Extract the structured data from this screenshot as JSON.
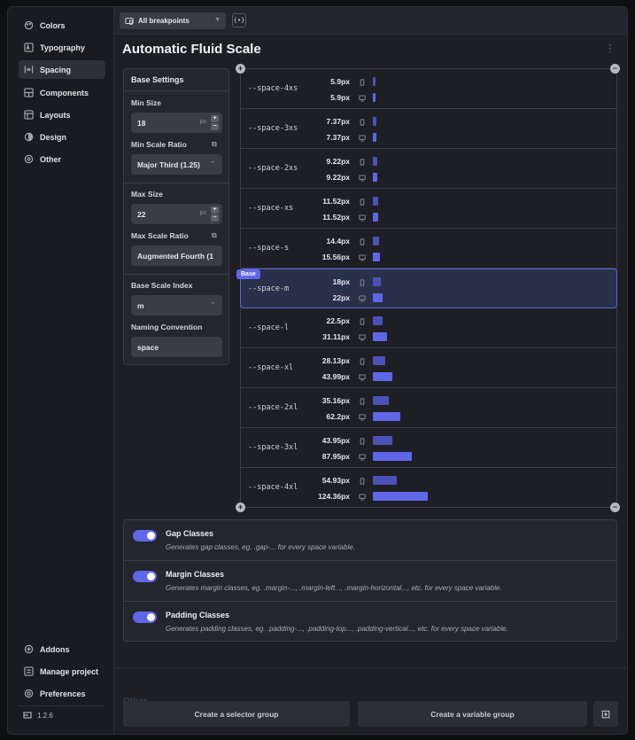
{
  "sidebar": {
    "items": [
      {
        "label": "Colors",
        "icon": "palette-icon"
      },
      {
        "label": "Typography",
        "icon": "typography-icon"
      },
      {
        "label": "Spacing",
        "icon": "spacing-icon"
      },
      {
        "label": "Components",
        "icon": "components-icon"
      },
      {
        "label": "Layouts",
        "icon": "layouts-icon"
      },
      {
        "label": "Design",
        "icon": "design-icon"
      },
      {
        "label": "Other",
        "icon": "other-icon"
      }
    ],
    "bottom_items": [
      {
        "label": "Addons",
        "icon": "addons-icon"
      },
      {
        "label": "Manage project",
        "icon": "manage-project-icon"
      },
      {
        "label": "Preferences",
        "icon": "preferences-icon"
      }
    ],
    "version": "1.2.6",
    "active": "Spacing"
  },
  "topbar": {
    "breakpoint_select": "All breakpoints",
    "code_button": "{•}"
  },
  "page_title": "Automatic Fluid Scale",
  "settings": {
    "header": "Base Settings",
    "min_size_label": "Min Size",
    "min_size_value": "18",
    "min_size_unit": "px",
    "min_scale_ratio_label": "Min Scale Ratio",
    "min_scale_ratio_value": "Major Third (1.25)",
    "max_size_label": "Max Size",
    "max_size_value": "22",
    "max_size_unit": "px",
    "max_scale_ratio_label": "Max Scale Ratio",
    "max_scale_ratio_value": "Augmented Fourth (1",
    "base_scale_index_label": "Base Scale Index",
    "base_scale_index_value": "m",
    "naming_convention_label": "Naming Convention",
    "naming_convention_value": "space"
  },
  "scale": {
    "base_badge": "Base",
    "base_index": 5,
    "rows": [
      {
        "name": "--space-4xs",
        "min": "5.9px",
        "max": "5.9px",
        "min_val": 5.9,
        "max_val": 5.9
      },
      {
        "name": "--space-3xs",
        "min": "7.37px",
        "max": "7.37px",
        "min_val": 7.37,
        "max_val": 7.37
      },
      {
        "name": "--space-2xs",
        "min": "9.22px",
        "max": "9.22px",
        "min_val": 9.22,
        "max_val": 9.22
      },
      {
        "name": "--space-xs",
        "min": "11.52px",
        "max": "11.52px",
        "min_val": 11.52,
        "max_val": 11.52
      },
      {
        "name": "--space-s",
        "min": "14.4px",
        "max": "15.56px",
        "min_val": 14.4,
        "max_val": 15.56
      },
      {
        "name": "--space-m",
        "min": "18px",
        "max": "22px",
        "min_val": 18,
        "max_val": 22
      },
      {
        "name": "--space-l",
        "min": "22.5px",
        "max": "31.11px",
        "min_val": 22.5,
        "max_val": 31.11
      },
      {
        "name": "--space-xl",
        "min": "28.13px",
        "max": "43.99px",
        "min_val": 28.13,
        "max_val": 43.99
      },
      {
        "name": "--space-2xl",
        "min": "35.16px",
        "max": "62.2px",
        "min_val": 35.16,
        "max_val": 62.2
      },
      {
        "name": "--space-3xl",
        "min": "43.95px",
        "max": "87.95px",
        "min_val": 43.95,
        "max_val": 87.95
      },
      {
        "name": "--space-4xl",
        "min": "54.93px",
        "max": "124.36px",
        "min_val": 54.93,
        "max_val": 124.36
      }
    ]
  },
  "classes": [
    {
      "title": "Gap Classes",
      "desc": "Generates gap classes, eg. .gap-... for every space variable.",
      "enabled": true
    },
    {
      "title": "Margin Classes",
      "desc": "Generates margin classes, eg. .margin-..., .margin-left..., .margin-horizontal..., etc. for every space variable.",
      "enabled": true
    },
    {
      "title": "Padding Classes",
      "desc": "Generates padding classes, eg. .padding-..., .padding-top..., .padding-vertical..., etc. for every space variable.",
      "enabled": true
    }
  ],
  "footer": {
    "ghost_heading": "Other",
    "create_selector_group": "Create a selector group",
    "create_variable_group": "Create a variable group"
  },
  "colors": {
    "accent": "#5f67e8",
    "bar_min": "#4b52b5",
    "panel": "#23262c"
  }
}
